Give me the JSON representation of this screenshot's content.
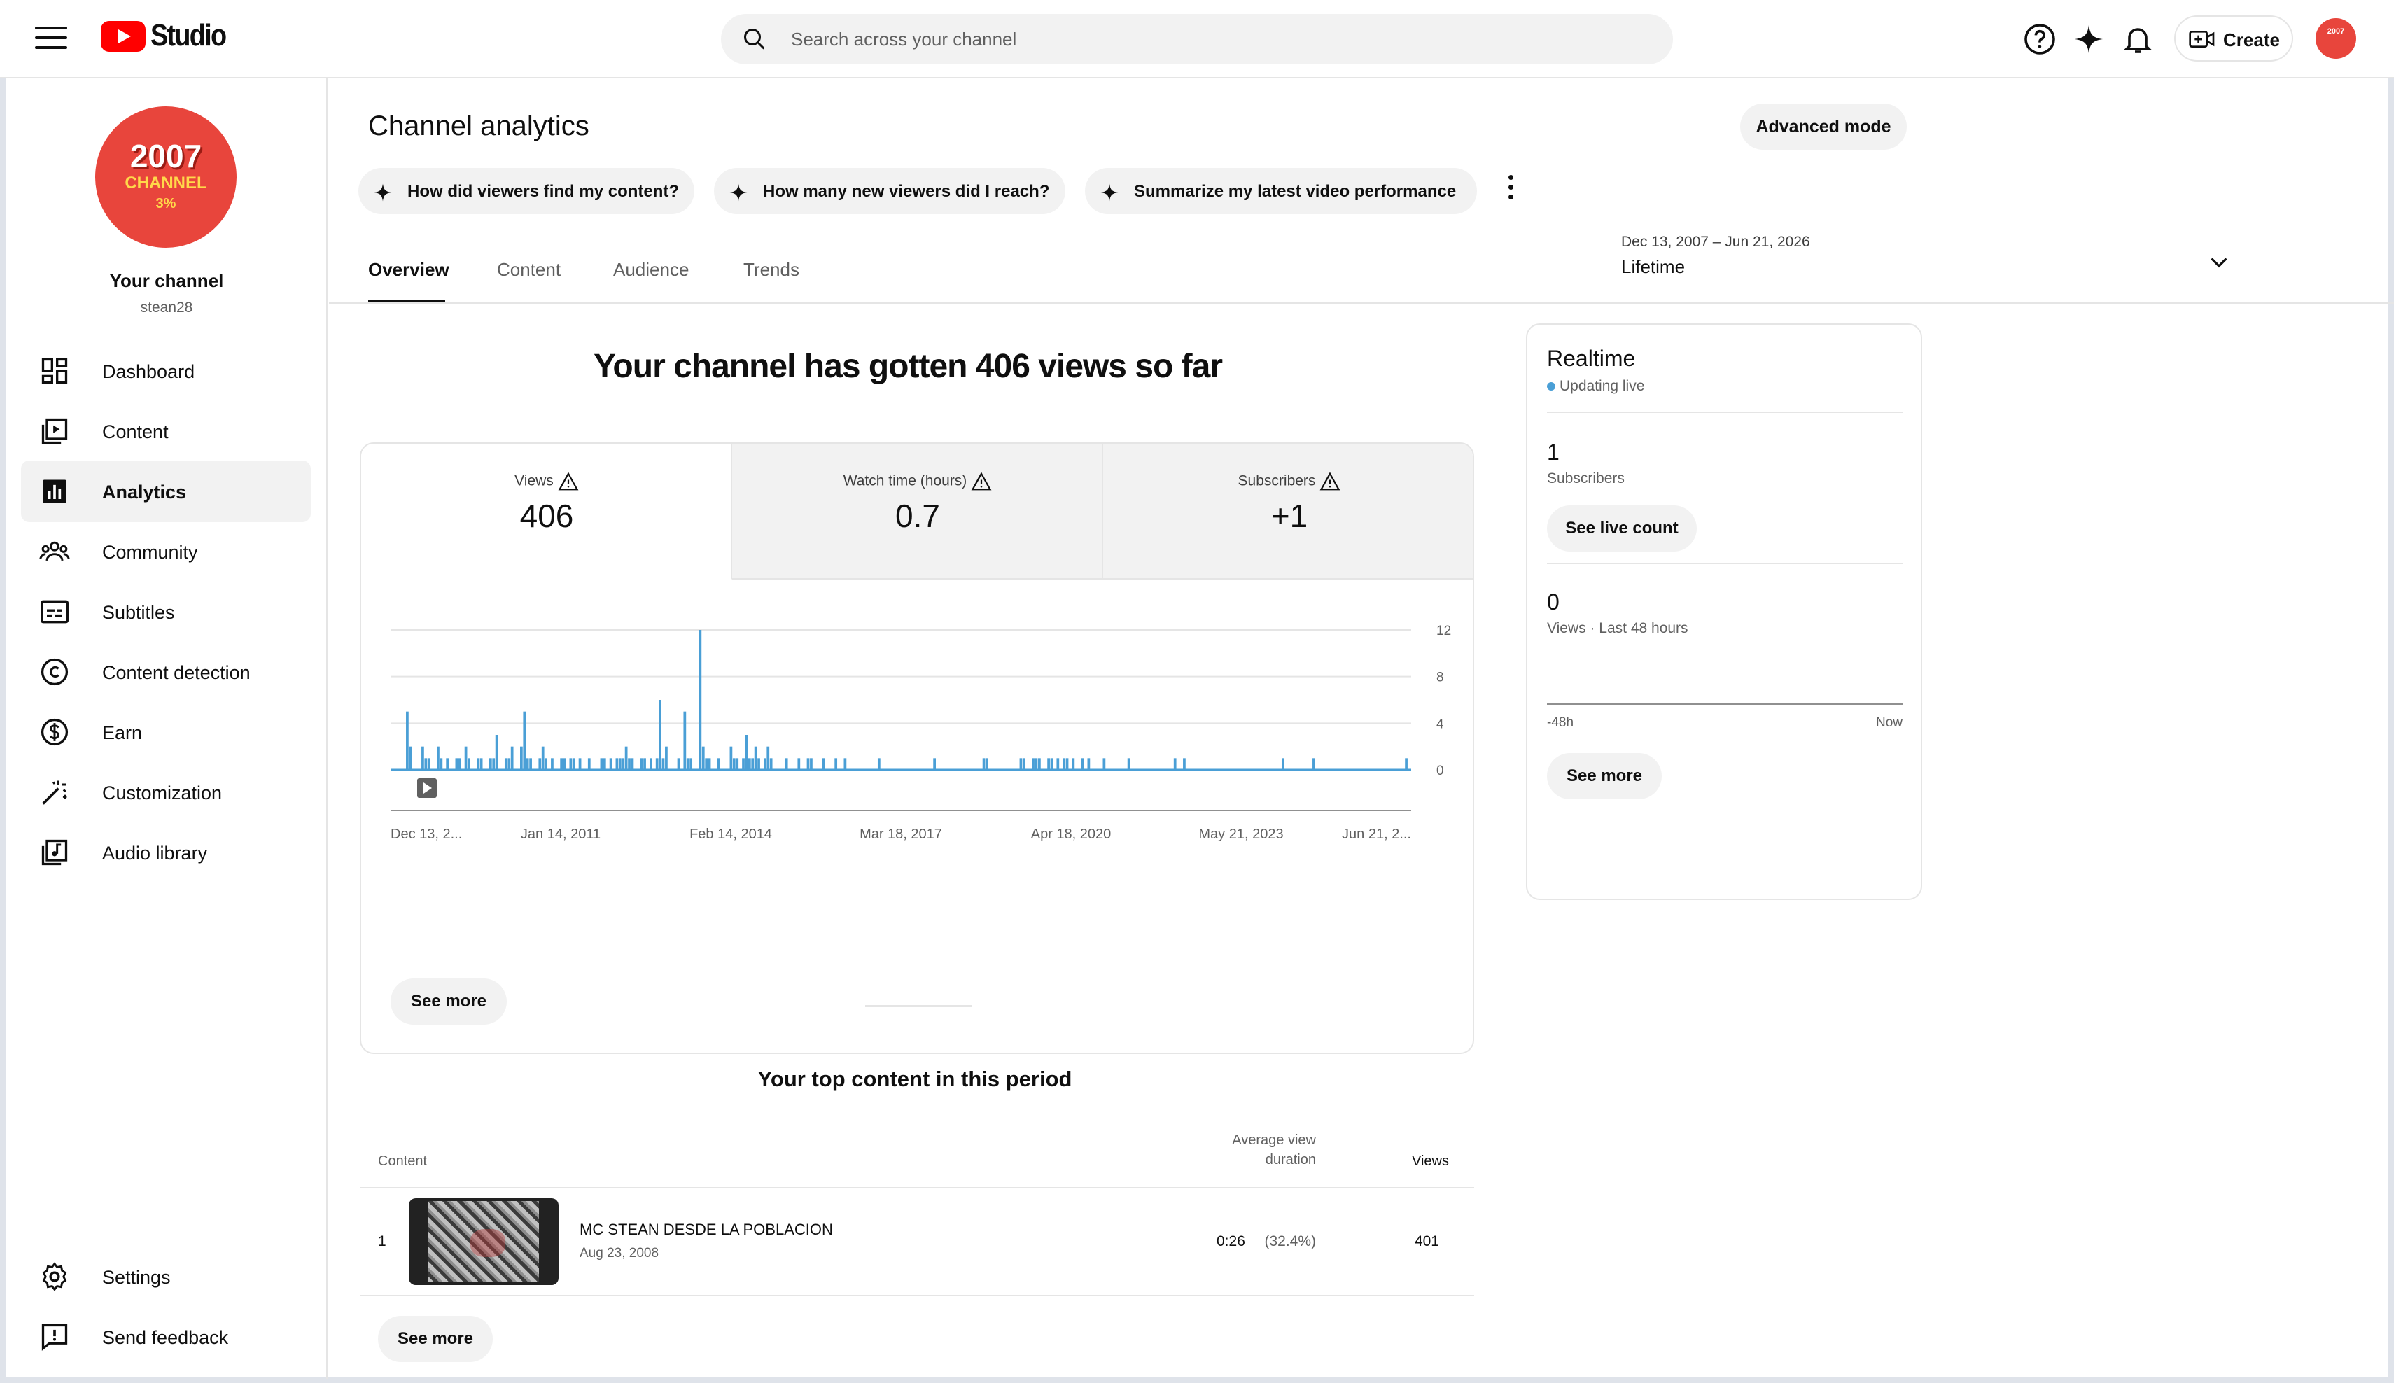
{
  "header": {
    "logo_text": "Studio",
    "search_placeholder": "Search across your channel",
    "create_label": "Create",
    "avatar_text": "2007"
  },
  "sidebar": {
    "avatar": {
      "line1": "2007",
      "line2": "CHANNEL",
      "line3": "3%"
    },
    "channel_title": "Your channel",
    "channel_handle": "stean28",
    "items": [
      {
        "label": "Dashboard",
        "icon": "dashboard-icon"
      },
      {
        "label": "Content",
        "icon": "content-icon"
      },
      {
        "label": "Analytics",
        "icon": "analytics-icon",
        "active": true
      },
      {
        "label": "Community",
        "icon": "community-icon"
      },
      {
        "label": "Subtitles",
        "icon": "subtitles-icon"
      },
      {
        "label": "Content detection",
        "icon": "copyright-icon"
      },
      {
        "label": "Earn",
        "icon": "dollar-icon"
      },
      {
        "label": "Customization",
        "icon": "magic-wand-icon"
      },
      {
        "label": "Audio library",
        "icon": "audio-library-icon"
      }
    ],
    "bottom_items": [
      {
        "label": "Settings",
        "icon": "gear-icon"
      },
      {
        "label": "Send feedback",
        "icon": "feedback-icon"
      }
    ]
  },
  "main": {
    "title": "Channel analytics",
    "advanced_mode_label": "Advanced mode",
    "suggestion_chips": [
      "How did viewers find my content?",
      "How many new viewers did I reach?",
      "Summarize my latest video performance"
    ],
    "tabs": [
      "Overview",
      "Content",
      "Audience",
      "Trends"
    ],
    "active_tab": "Overview",
    "date_range": "Dec 13, 2007 – Jun 21, 2026",
    "date_period": "Lifetime",
    "headline": "Your channel has gotten 406 views so far",
    "metrics": [
      {
        "label": "Views",
        "value": "406",
        "warning": true,
        "active": true
      },
      {
        "label": "Watch time (hours)",
        "value": "0.7",
        "warning": true
      },
      {
        "label": "Subscribers",
        "value": "+1",
        "warning": true
      }
    ],
    "chart_see_more": "See more",
    "top_content": {
      "title": "Your top content in this period",
      "headers": {
        "content": "Content",
        "avg_view_duration_1": "Average view",
        "avg_view_duration_2": "duration",
        "views": "Views"
      },
      "rows": [
        {
          "rank": "1",
          "title": "MC STEAN DESDE LA POBLACION",
          "date": "Aug 23, 2008",
          "avg_duration": "0:26",
          "avg_pct": "(32.4%)",
          "views": "401"
        }
      ],
      "see_more": "See more"
    }
  },
  "realtime": {
    "title": "Realtime",
    "status": "Updating live",
    "subscribers_value": "1",
    "subscribers_label": "Subscribers",
    "see_live_count": "See live count",
    "views_value": "0",
    "views_label": "Views · Last 48 hours",
    "axis_start": "-48h",
    "axis_end": "Now",
    "see_more": "See more"
  },
  "colors": {
    "accent": "#4a9fd6",
    "brand": "#ff0000",
    "avatar": "#e8453c"
  },
  "chart_data": {
    "type": "bar",
    "series": [
      {
        "values": [
          0,
          0,
          0,
          0,
          0,
          5,
          2,
          0,
          0,
          0,
          2,
          1,
          1,
          0,
          0,
          2,
          1,
          0,
          1,
          0,
          0,
          1,
          1,
          0,
          2,
          1,
          0,
          0,
          1,
          1,
          0,
          0,
          1,
          1,
          3,
          0,
          0,
          1,
          1,
          2,
          0,
          0,
          2,
          5,
          1,
          1,
          0,
          0,
          1,
          2,
          1,
          0,
          1,
          0,
          0,
          1,
          1,
          0,
          1,
          1,
          0,
          1,
          0,
          0,
          1,
          0,
          0,
          0,
          1,
          1,
          0,
          1,
          0,
          1,
          1,
          1,
          2,
          1,
          1,
          0,
          0,
          1,
          1,
          0,
          1,
          0,
          1,
          6,
          1,
          2,
          0,
          0,
          0,
          1,
          0,
          5,
          1,
          1,
          0,
          0,
          12,
          2,
          1,
          1,
          0,
          0,
          1,
          0,
          0,
          0,
          2,
          1,
          1,
          0,
          1,
          3,
          1,
          1,
          2,
          1,
          0,
          1,
          2,
          1,
          0,
          0,
          0,
          0,
          1,
          0,
          0,
          0,
          1,
          0,
          0,
          1,
          1,
          0,
          0,
          0,
          1,
          0,
          0,
          0,
          1,
          0,
          0,
          1,
          0,
          0,
          0,
          0,
          0,
          0,
          0,
          0,
          0,
          0,
          1,
          0,
          0,
          0,
          0,
          0,
          0,
          0,
          0,
          0,
          0,
          0,
          0,
          0,
          0,
          0,
          0,
          0,
          1,
          0,
          0,
          0,
          0,
          0,
          0,
          0,
          0,
          0,
          0,
          0,
          0,
          0,
          0,
          0,
          1,
          1,
          0,
          0,
          0,
          0,
          0,
          0,
          0,
          0,
          0,
          0,
          1,
          1,
          0,
          0,
          1,
          1,
          1,
          0,
          0,
          1,
          1,
          0,
          1,
          0,
          1,
          1,
          0,
          1,
          0,
          0,
          1,
          0,
          1,
          0,
          0,
          0,
          0,
          1,
          0,
          0,
          0,
          0,
          0,
          0,
          0,
          1,
          0,
          0,
          0,
          0,
          0,
          0,
          0,
          0,
          0,
          0,
          0,
          0,
          0,
          0,
          1,
          0,
          0,
          1,
          0,
          0,
          0,
          0,
          0,
          0,
          0,
          0,
          0,
          0,
          0,
          0,
          0,
          0,
          0,
          0,
          0,
          0,
          0,
          0,
          0,
          0,
          0,
          0,
          0,
          0,
          0,
          0,
          0,
          0,
          0,
          1,
          0,
          0,
          0,
          0,
          0,
          0,
          0,
          0,
          0,
          1,
          0,
          0,
          0,
          0,
          0,
          0,
          0,
          0,
          0,
          0,
          0,
          0,
          0,
          0,
          0,
          0,
          0,
          0,
          0,
          0,
          0,
          0,
          0,
          0,
          0,
          0,
          0,
          0,
          0,
          1,
          0
        ]
      }
    ],
    "x_tick_labels": [
      "Dec 13, 2...",
      "Jan 14, 2011",
      "Feb 14, 2014",
      "Mar 18, 2017",
      "Apr 18, 2020",
      "May 21, 2023",
      "Jun 21, 2..."
    ],
    "y_tick_labels": [
      "12",
      "8",
      "4",
      "0"
    ],
    "ylim": [
      0,
      12
    ],
    "grid": true,
    "annotation": "video-published-marker"
  }
}
